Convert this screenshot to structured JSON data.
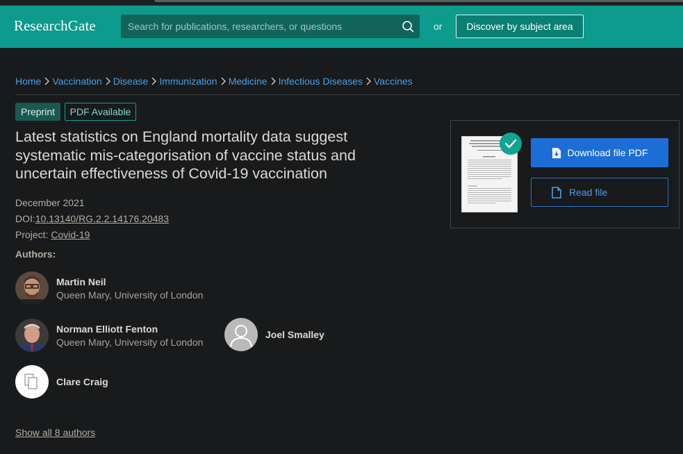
{
  "header": {
    "logo": "ResearchGate",
    "search_placeholder": "Search for publications, researchers, or questions",
    "or_label": "or",
    "discover_label": "Discover by subject area"
  },
  "breadcrumb": [
    "Home",
    "Vaccination",
    "Disease",
    "Immunization",
    "Medicine",
    "Infectious Diseases",
    "Vaccines"
  ],
  "badges": {
    "preprint": "Preprint",
    "pdf": "PDF Available"
  },
  "title_lines": [
    "Latest statistics on England mortality data suggest",
    "systematic mis-categorisation of vaccine status and",
    "uncertain effectiveness of Covid-19 vaccination"
  ],
  "meta": {
    "date": "December 2021",
    "doi_label": "DOI:",
    "doi": "10.13140/RG.2.2.14176.20483",
    "project_label": "Project:",
    "project": "Covid-19"
  },
  "authors_heading": "Authors:",
  "authors": [
    {
      "name": "Martin Neil",
      "affiliation": "Queen Mary, University of London"
    },
    {
      "name": "Norman Elliott Fenton",
      "affiliation": "Queen Mary, University of London"
    },
    {
      "name": "Joel Smalley",
      "affiliation": ""
    },
    {
      "name": "Clare Craig",
      "affiliation": ""
    }
  ],
  "show_all": "Show all 8 authors",
  "panel": {
    "download_label": "Download file PDF",
    "read_label": "Read file"
  },
  "colors": {
    "brand": "#0c9b8c",
    "link": "#4d9fe3",
    "primary_button": "#1c6ed6",
    "background": "#181a1b"
  }
}
